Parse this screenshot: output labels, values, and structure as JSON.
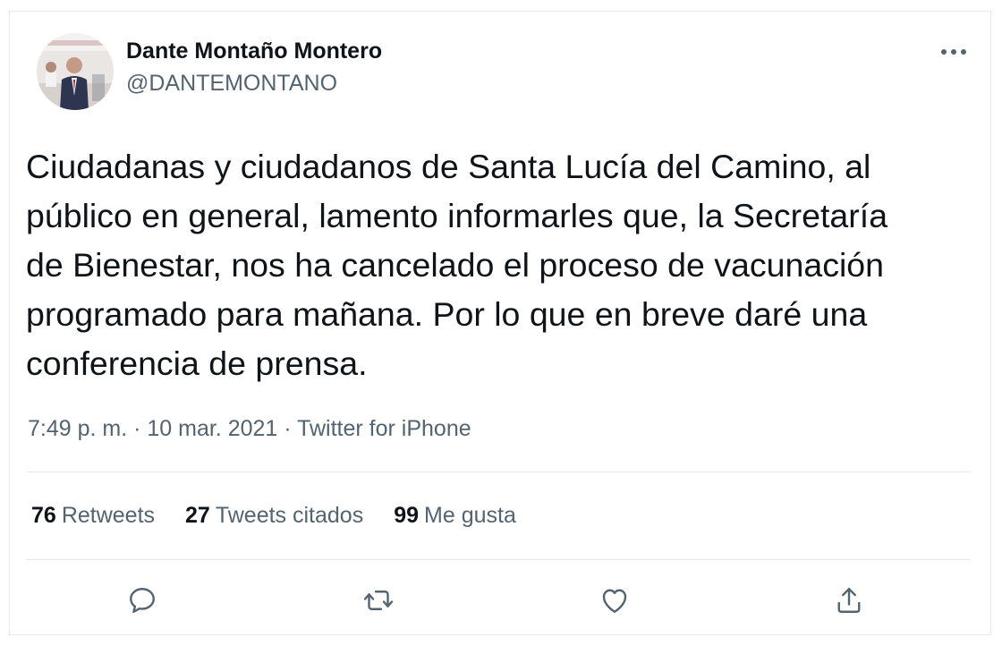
{
  "author": {
    "name": "Dante Montaño Montero",
    "handle": "@DANTEMONTANO"
  },
  "tweet": {
    "lines": [
      "Ciudadanas y ciudadanos de Santa Lucía del Camino, al",
      "público en general, lamento informarles que, la Secretaría",
      "de Bienestar, nos ha cancelado el proceso de vacunación",
      "programado para mañana. Por lo que en breve daré una",
      "conferencia de prensa."
    ],
    "time": "7:49 p. m.",
    "separator": " · ",
    "date": "10 mar. 2021",
    "source": "Twitter for iPhone"
  },
  "stats": {
    "retweets": {
      "count": "76",
      "label": "Retweets"
    },
    "quotes": {
      "count": "27",
      "label": "Tweets citados"
    },
    "likes": {
      "count": "99",
      "label": "Me gusta"
    }
  },
  "actions": {
    "reply_icon": "reply-icon",
    "retweet_icon": "retweet-icon",
    "like_icon": "heart-icon",
    "share_icon": "share-icon"
  },
  "colors": {
    "text": "#0f1419",
    "secondary": "#536471",
    "border": "#e7e9ea"
  }
}
